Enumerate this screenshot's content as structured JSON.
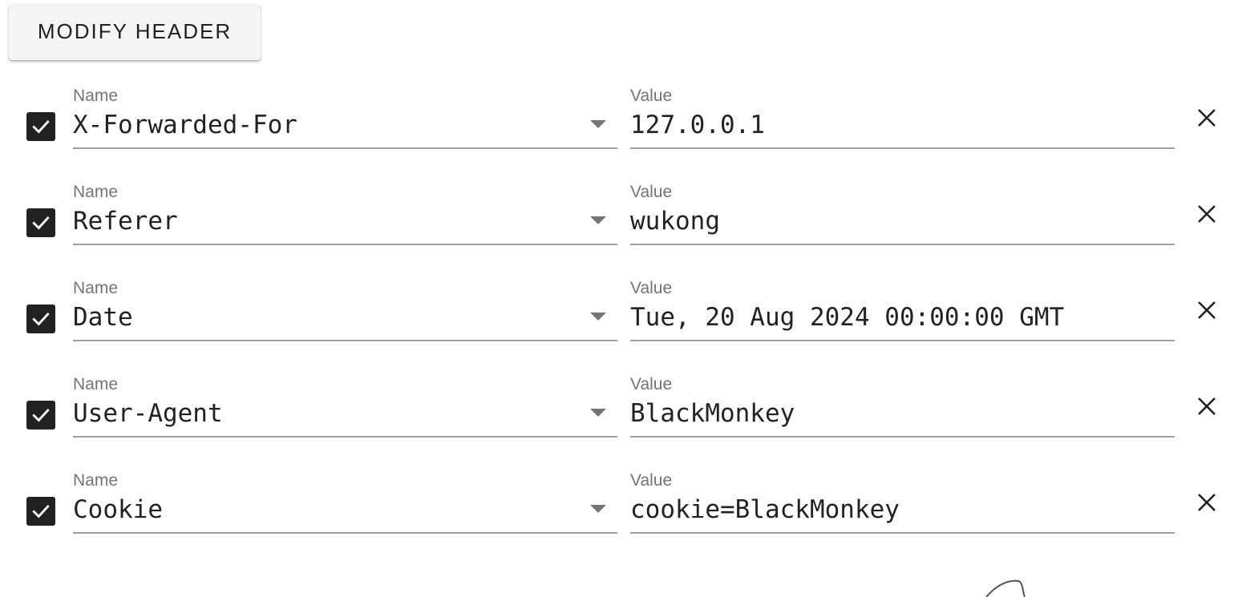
{
  "toolbar": {
    "modify_header_label": "MODIFY HEADER"
  },
  "headers": [
    {
      "enabled": true,
      "name_label": "Name",
      "name": "X-Forwarded-For",
      "value_label": "Value",
      "value": "127.0.0.1"
    },
    {
      "enabled": true,
      "name_label": "Name",
      "name": "Referer",
      "value_label": "Value",
      "value": "wukong"
    },
    {
      "enabled": true,
      "name_label": "Name",
      "name": "Date",
      "value_label": "Value",
      "value": "Tue, 20 Aug 2024 00:00:00 GMT"
    },
    {
      "enabled": true,
      "name_label": "Name",
      "name": "User-Agent",
      "value_label": "Value",
      "value": "BlackMonkey"
    },
    {
      "enabled": true,
      "name_label": "Name",
      "name": "Cookie",
      "value_label": "Value",
      "value": "cookie=BlackMonkey"
    }
  ],
  "icons": {
    "checkbox": "checkbox-checked-icon",
    "dropdown": "dropdown-arrow-icon",
    "remove": "close-icon"
  },
  "colors": {
    "checkbox_fill": "#212121",
    "label": "#757575",
    "underline": "#9e9e9e",
    "text": "#222222",
    "button_bg": "#f5f5f5"
  }
}
